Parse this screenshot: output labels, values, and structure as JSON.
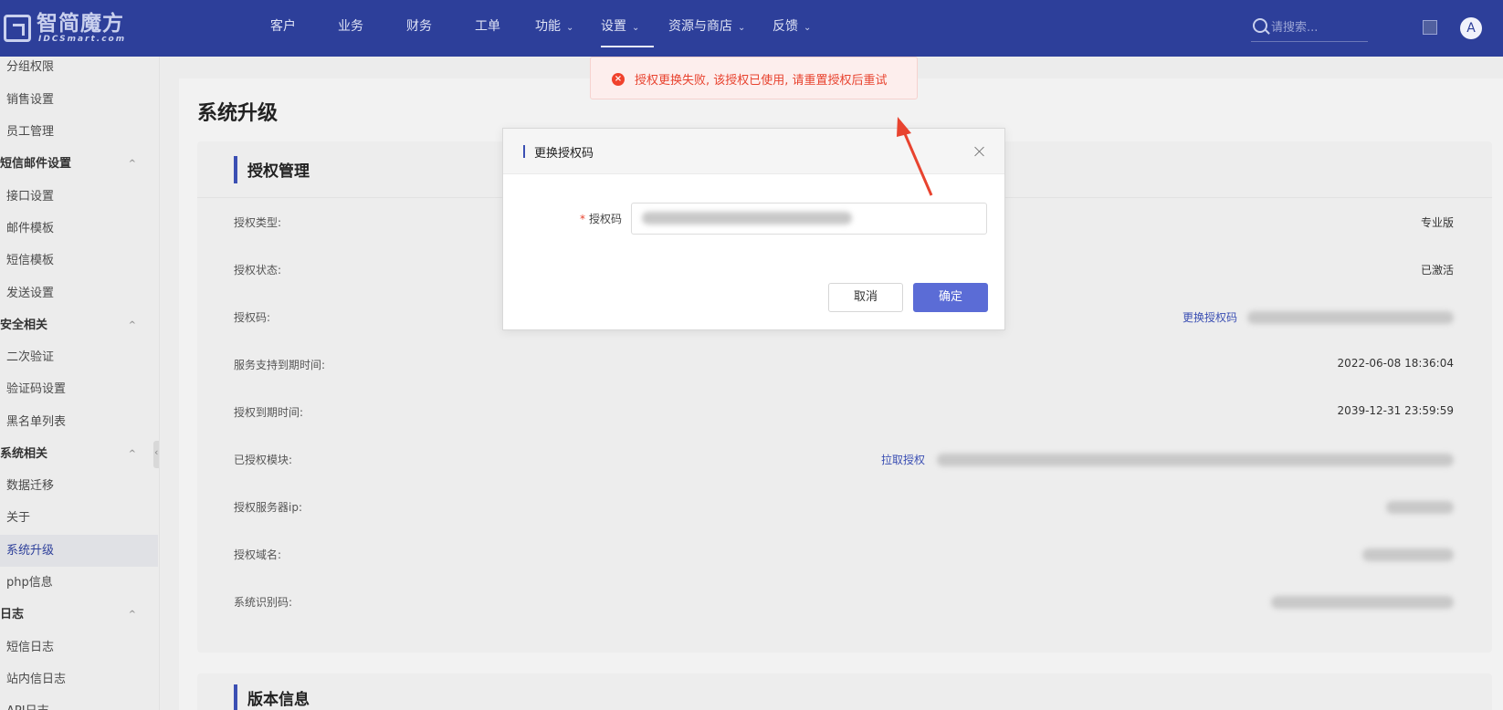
{
  "header": {
    "logo_title": "智简魔方",
    "logo_subtitle": "IDCSmart.com",
    "nav": [
      {
        "label": "客户",
        "has_menu": false
      },
      {
        "label": "业务",
        "has_menu": false
      },
      {
        "label": "财务",
        "has_menu": false
      },
      {
        "label": "工单",
        "has_menu": false
      },
      {
        "label": "功能",
        "has_menu": true
      },
      {
        "label": "设置",
        "has_menu": true,
        "active": true
      },
      {
        "label": "资源与商店",
        "has_menu": true
      },
      {
        "label": "反馈",
        "has_menu": true
      }
    ],
    "search_placeholder": "请搜索...",
    "avatar_letter": "A"
  },
  "sidebar": {
    "rows": [
      {
        "type": "item",
        "label": "分组权限"
      },
      {
        "type": "item",
        "label": "销售设置"
      },
      {
        "type": "item",
        "label": "员工管理"
      },
      {
        "type": "group",
        "label": "短信邮件设置"
      },
      {
        "type": "item",
        "label": "接口设置"
      },
      {
        "type": "item",
        "label": "邮件模板"
      },
      {
        "type": "item",
        "label": "短信模板"
      },
      {
        "type": "item",
        "label": "发送设置"
      },
      {
        "type": "group",
        "label": "安全相关"
      },
      {
        "type": "item",
        "label": "二次验证"
      },
      {
        "type": "item",
        "label": "验证码设置"
      },
      {
        "type": "item",
        "label": "黑名单列表"
      },
      {
        "type": "group",
        "label": "系统相关"
      },
      {
        "type": "item",
        "label": "数据迁移"
      },
      {
        "type": "item",
        "label": "关于"
      },
      {
        "type": "item",
        "label": "系统升级",
        "active": true
      },
      {
        "type": "item",
        "label": "php信息"
      },
      {
        "type": "group",
        "label": "日志"
      },
      {
        "type": "item",
        "label": "短信日志"
      },
      {
        "type": "item",
        "label": "站内信日志"
      },
      {
        "type": "item",
        "label": "API日志"
      }
    ]
  },
  "page": {
    "title": "系统升级",
    "license_panel_title": "授权管理",
    "version_panel_title": "版本信息",
    "rows": {
      "type": {
        "label": "授权类型:",
        "value": "专业版"
      },
      "status": {
        "label": "授权状态:",
        "value": "已激活"
      },
      "code": {
        "label": "授权码:",
        "link": "更换授权码"
      },
      "service_expiry": {
        "label": "服务支持到期时间:",
        "value": "2022-06-08 18:36:04"
      },
      "license_expiry": {
        "label": "授权到期时间:",
        "value": "2039-12-31 23:59:59"
      },
      "modules": {
        "label": "已授权模块:",
        "link": "拉取授权"
      },
      "server_ip": {
        "label": "授权服务器ip:"
      },
      "domain": {
        "label": "授权域名:"
      },
      "system_code": {
        "label": "系统识别码:"
      }
    }
  },
  "toast": {
    "type": "error",
    "message": "授权更换失败, 该授权已使用, 请重置授权后重试"
  },
  "modal": {
    "title": "更换授权码",
    "field_label": "授权码",
    "field_required_mark": "*",
    "cancel_label": "取消",
    "confirm_label": "确定"
  },
  "colors": {
    "header_bg": "#2d3f9a",
    "accent": "#3b4fb3",
    "primary_button": "#5b6cd6",
    "error": "#e8432f",
    "annotation_arrow": "#e8432f"
  }
}
